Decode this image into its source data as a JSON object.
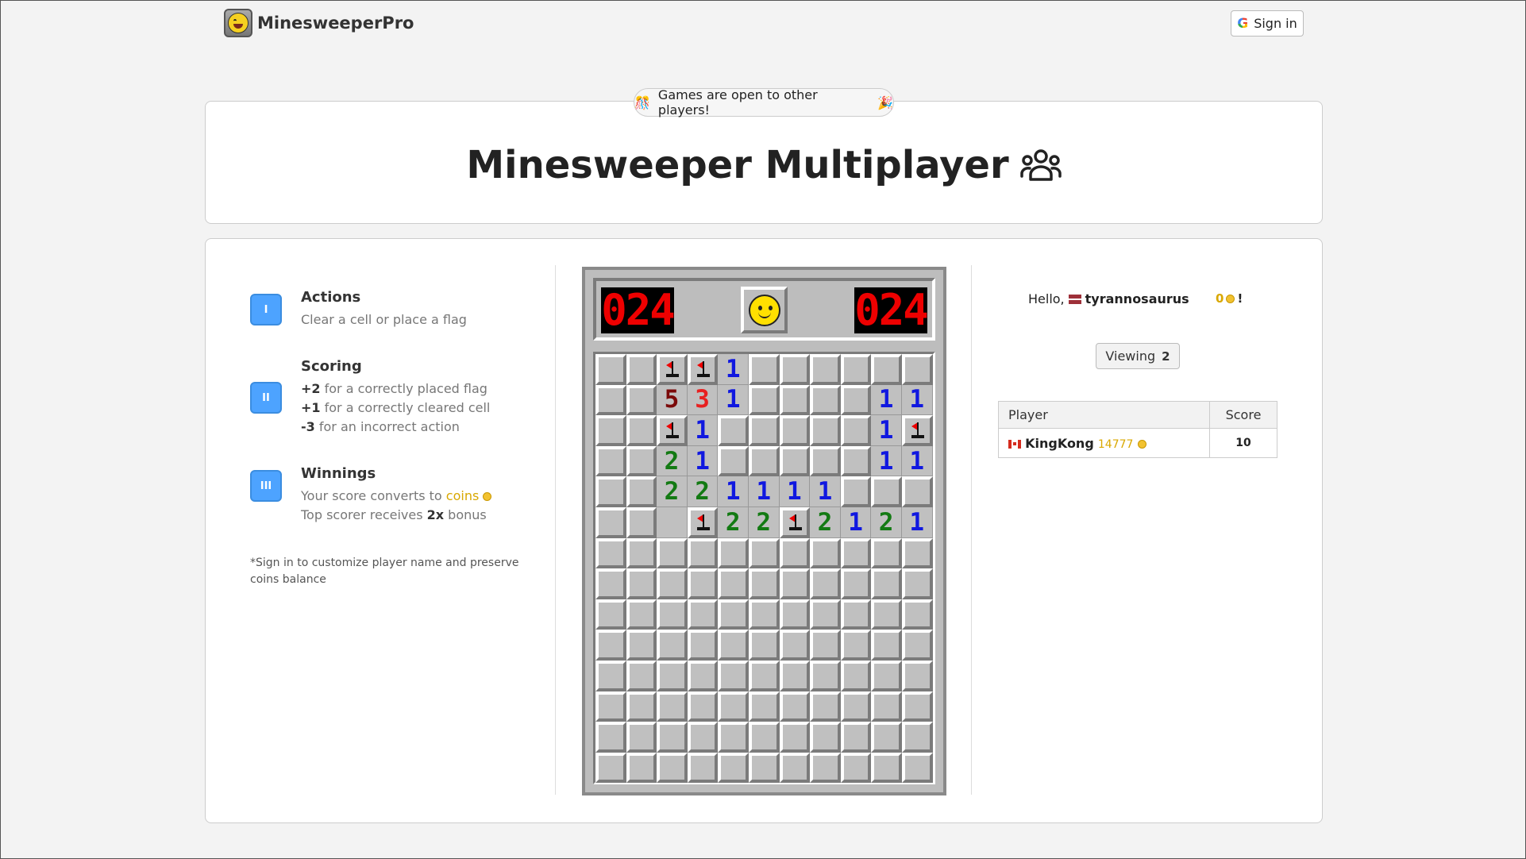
{
  "header": {
    "brand": "MinesweeperPro",
    "signin_label": "Sign in"
  },
  "banner": {
    "text": "Games are open to other players!"
  },
  "page_title": "Minesweeper Multiplayer",
  "instructions": {
    "actions": {
      "badge": "I",
      "title": "Actions",
      "line": "Clear a cell or place a flag"
    },
    "scoring": {
      "badge": "II",
      "title": "Scoring",
      "lines": [
        {
          "points": "+2",
          "text": " for a correctly placed flag"
        },
        {
          "points": "+1",
          "text": " for a correctly cleared cell"
        },
        {
          "points": "-3",
          "text": " for an incorrect action"
        }
      ]
    },
    "winnings": {
      "badge": "III",
      "title": "Winnings",
      "line1_prefix": "Your score converts to ",
      "line1_word": "coins",
      "line2_prefix": "Top scorer receives ",
      "line2_bold": "2x",
      "line2_suffix": " bonus"
    },
    "note": "*Sign in to customize player name and preserve coins balance"
  },
  "game": {
    "mine_counter": "024",
    "timer": "024",
    "board": [
      "CCFF1CCCCCC",
      "CC531CCCC11",
      "CCF1CCCCC1F",
      "CC21CCCCC11",
      "CC221111CCC",
      "CC0F22F2121",
      "CCCCCCCCCCC",
      "CCCCCCCCCCC",
      "CCCCCCCCCCC",
      "CCCCCCCCCCC",
      "CCCCCCCCCCC",
      "CCCCCCCCCCC",
      "CCCCCCCCCCC",
      "CCCCCCCCCCC"
    ]
  },
  "player_panel": {
    "hello_prefix": "Hello,",
    "username": "tyrannosaurus",
    "balance": "0",
    "balance_suffix": "!",
    "viewing_label": "Viewing",
    "viewing_count": "2",
    "columns": [
      "Player",
      "Score"
    ],
    "rows": [
      {
        "name": "KingKong",
        "coins": "14777",
        "score": "10"
      }
    ]
  },
  "colors": {
    "accent": "#4da3ff",
    "coin": "#d9a800",
    "lcd": "#e00000"
  }
}
